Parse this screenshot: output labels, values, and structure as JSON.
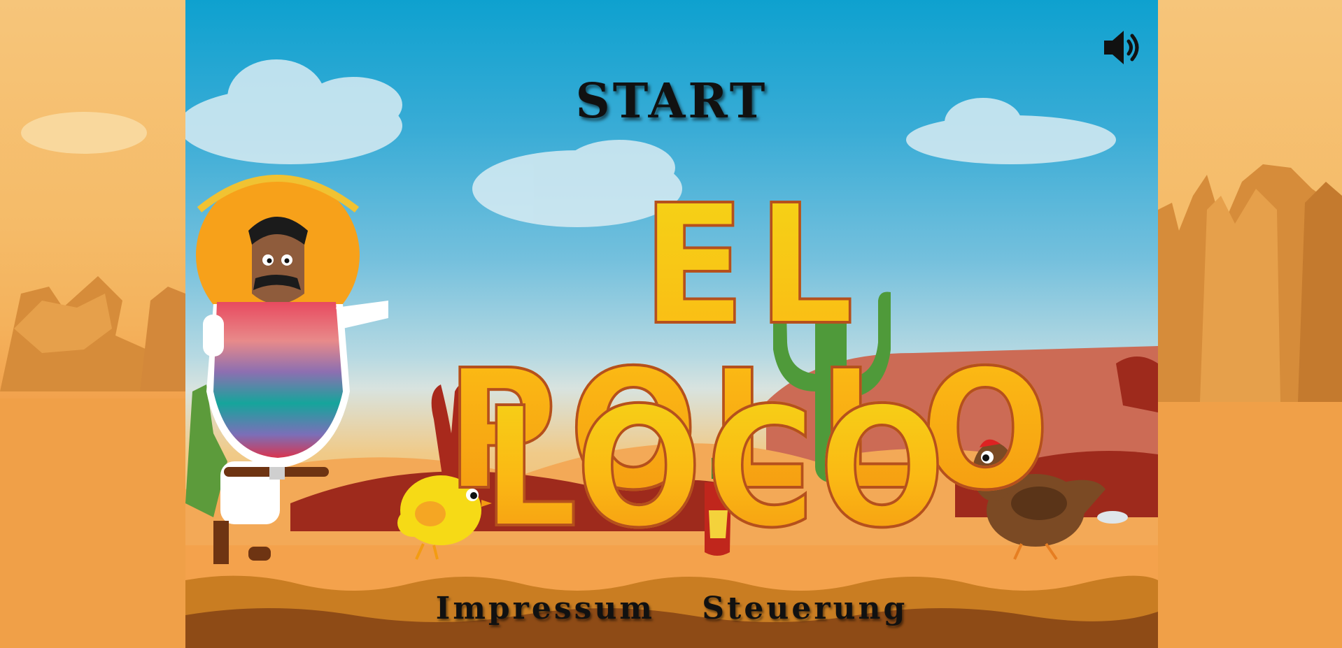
{
  "menu": {
    "start_label": "START",
    "sound_icon": "speaker-volume-icon",
    "sound_state": "on"
  },
  "title": {
    "line1": "EL POLLO",
    "line2": "LOCO"
  },
  "footer": {
    "impressum_label": "Impressum",
    "controls_label": "Steuerung"
  },
  "colors": {
    "title_fill": "#fbb914",
    "title_outline": "#b5501d",
    "sky_top": "#0ea1cf",
    "desert_sand": "#f0a24c",
    "text_dark": "#111111"
  }
}
